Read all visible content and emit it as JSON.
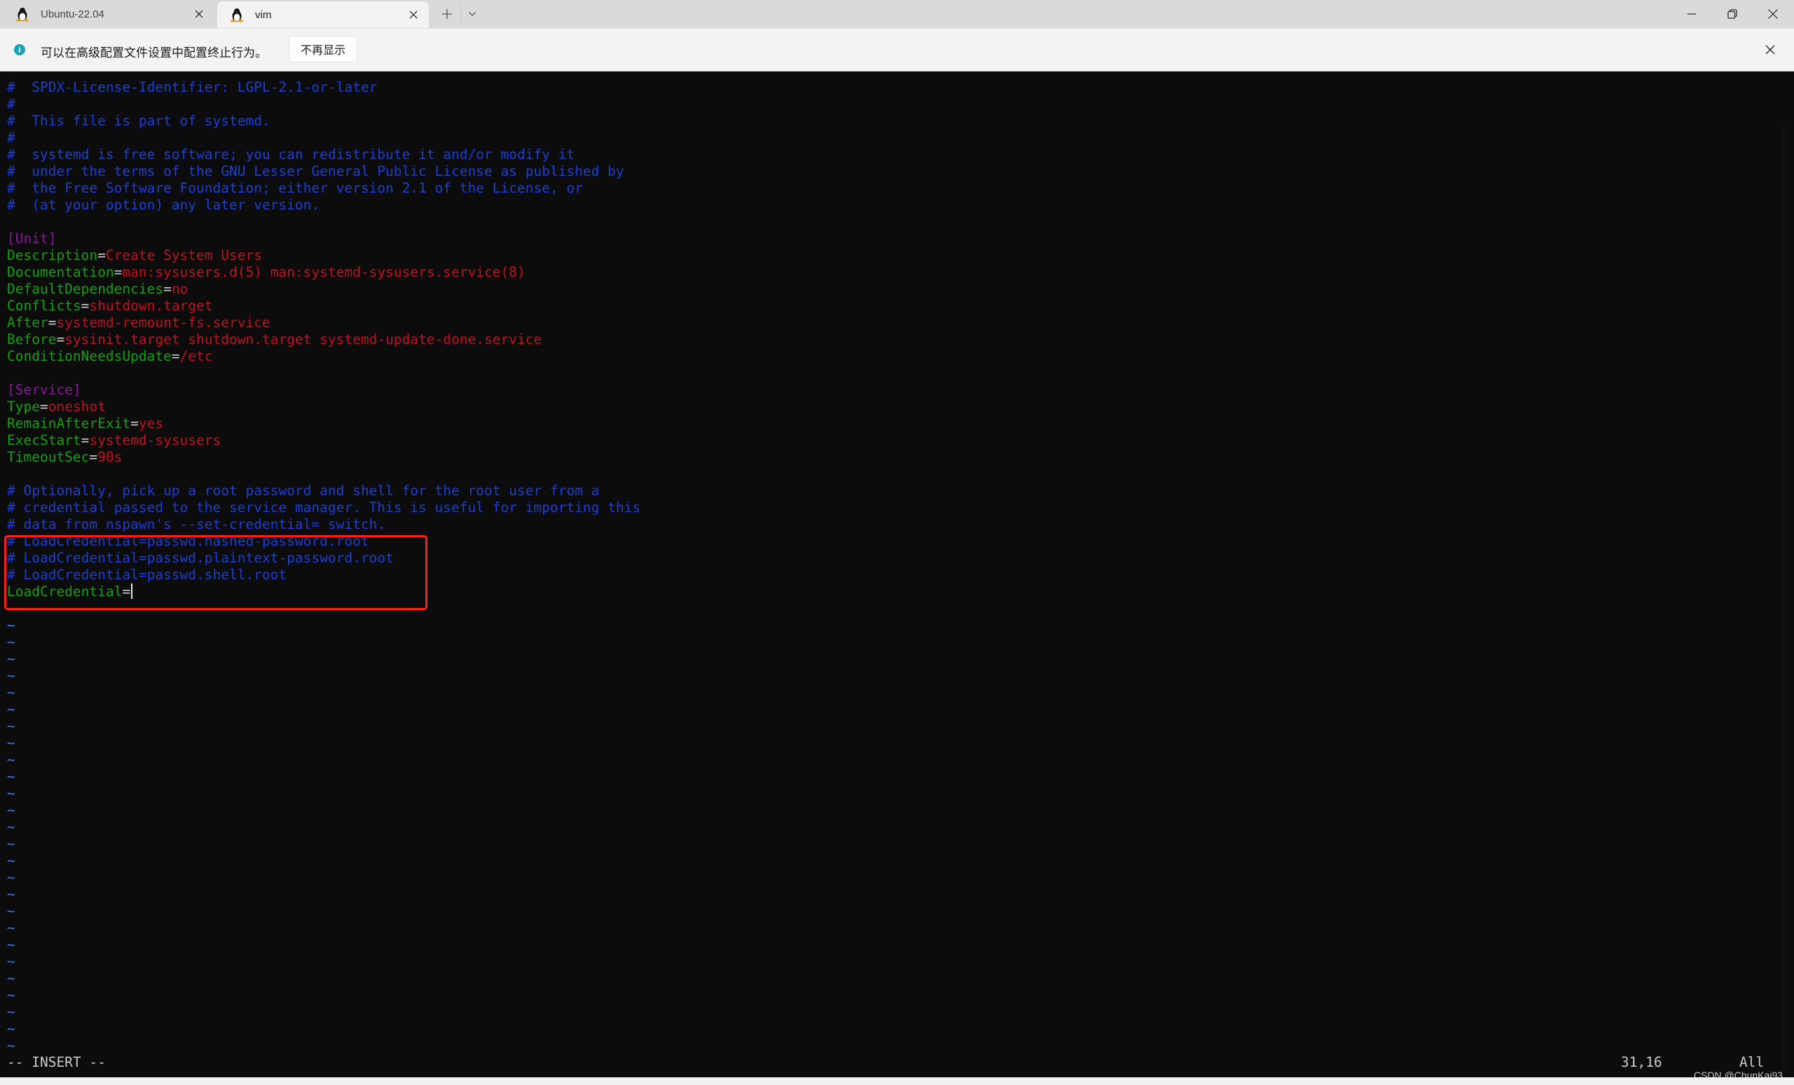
{
  "tabs": [
    {
      "title": "Ubuntu-22.04",
      "icon": "linux-penguin-icon",
      "active": false
    },
    {
      "title": "vim",
      "icon": "linux-penguin-icon",
      "active": true
    }
  ],
  "tabbar": {
    "new_tab_icon": "plus-icon",
    "dropdown_icon": "chevron-down-icon"
  },
  "window_controls": {
    "minimize": "minimize-icon",
    "restore": "restore-icon",
    "close": "close-icon"
  },
  "infobar": {
    "icon": "info-icon",
    "icon_glyph": "i",
    "message": "可以在高级配置文件设置中配置终止行为。",
    "dismiss_label": "不再显示",
    "close_icon": "close-icon"
  },
  "editor": {
    "lines": [
      [
        {
          "t": "comment",
          "s": "#  SPDX-License-Identifier: LGPL-2.1-or-later"
        }
      ],
      [
        {
          "t": "comment",
          "s": "#"
        }
      ],
      [
        {
          "t": "comment",
          "s": "#  This file is part of systemd."
        }
      ],
      [
        {
          "t": "comment",
          "s": "#"
        }
      ],
      [
        {
          "t": "comment",
          "s": "#  systemd is free software; you can redistribute it and/or modify it"
        }
      ],
      [
        {
          "t": "comment",
          "s": "#  under the terms of the GNU Lesser General Public License as published by"
        }
      ],
      [
        {
          "t": "comment",
          "s": "#  the Free Software Foundation; either version 2.1 of the License, or"
        }
      ],
      [
        {
          "t": "comment",
          "s": "#  (at your option) any later version."
        }
      ],
      [],
      [
        {
          "t": "sect",
          "s": "[Unit]"
        }
      ],
      [
        {
          "t": "key",
          "s": "Description"
        },
        {
          "t": "eq",
          "s": "="
        },
        {
          "t": "val",
          "s": "Create System Users"
        }
      ],
      [
        {
          "t": "key",
          "s": "Documentation"
        },
        {
          "t": "eq",
          "s": "="
        },
        {
          "t": "val",
          "s": "man:sysusers.d(5) man:systemd-sysusers.service(8)"
        }
      ],
      [
        {
          "t": "key",
          "s": "DefaultDependencies"
        },
        {
          "t": "eq",
          "s": "="
        },
        {
          "t": "val",
          "s": "no"
        }
      ],
      [
        {
          "t": "key",
          "s": "Conflicts"
        },
        {
          "t": "eq",
          "s": "="
        },
        {
          "t": "val",
          "s": "shutdown.target"
        }
      ],
      [
        {
          "t": "key",
          "s": "After"
        },
        {
          "t": "eq",
          "s": "="
        },
        {
          "t": "val",
          "s": "systemd-remount-fs.service"
        }
      ],
      [
        {
          "t": "key",
          "s": "Before"
        },
        {
          "t": "eq",
          "s": "="
        },
        {
          "t": "val",
          "s": "sysinit.target shutdown.target systemd-update-done.service"
        }
      ],
      [
        {
          "t": "key",
          "s": "ConditionNeedsUpdate"
        },
        {
          "t": "eq",
          "s": "="
        },
        {
          "t": "val",
          "s": "/etc"
        }
      ],
      [],
      [
        {
          "t": "sect",
          "s": "[Service]"
        }
      ],
      [
        {
          "t": "key",
          "s": "Type"
        },
        {
          "t": "eq",
          "s": "="
        },
        {
          "t": "val",
          "s": "oneshot"
        }
      ],
      [
        {
          "t": "key",
          "s": "RemainAfterExit"
        },
        {
          "t": "eq",
          "s": "="
        },
        {
          "t": "val",
          "s": "yes"
        }
      ],
      [
        {
          "t": "key",
          "s": "ExecStart"
        },
        {
          "t": "eq",
          "s": "="
        },
        {
          "t": "val",
          "s": "systemd-sysusers"
        }
      ],
      [
        {
          "t": "key",
          "s": "TimeoutSec"
        },
        {
          "t": "eq",
          "s": "="
        },
        {
          "t": "val",
          "s": "90s"
        }
      ],
      [],
      [
        {
          "t": "comment",
          "s": "# Optionally, pick up a root password and shell for the root user from a"
        }
      ],
      [
        {
          "t": "comment",
          "s": "# credential passed to the service manager. This is useful for importing this"
        }
      ],
      [
        {
          "t": "comment",
          "s": "# data from nspawn's --set-credential= switch."
        }
      ],
      [
        {
          "t": "comment",
          "s": "# LoadCredential=passwd.hashed-password.root"
        }
      ],
      [
        {
          "t": "comment",
          "s": "# LoadCredential=passwd.plaintext-password.root"
        }
      ],
      [
        {
          "t": "comment",
          "s": "# LoadCredential=passwd.shell.root"
        }
      ],
      [
        {
          "t": "key",
          "s": "LoadCredential"
        },
        {
          "t": "eq",
          "s": "="
        },
        {
          "t": "cursor",
          "s": ""
        }
      ]
    ],
    "tilde": "~",
    "tilde_count": 27,
    "highlight_color": "#ff1f1f",
    "colors": {
      "comment": "#1b3fd6",
      "key": "#13a10e",
      "value": "#c50f1f",
      "section": "#881798",
      "tilde": "#3b78ff"
    }
  },
  "statusline": {
    "mode": "-- INSERT --",
    "position": "31,16",
    "scroll": "All"
  },
  "watermark": "CSDN @ChunKai93"
}
